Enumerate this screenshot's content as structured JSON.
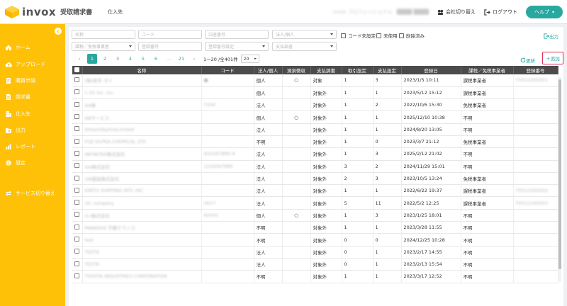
{
  "header": {
    "brand": "invox",
    "product": "受取請求書",
    "page_tab": "仕入先",
    "org_name": "invox プロフェッショナル",
    "user_name": "████ ████",
    "switch_company": "会社切り替え",
    "logout": "ログアウト",
    "help": "ヘルプ"
  },
  "colors": {
    "accent": "#29a8a0",
    "sidebar": "#ffc107",
    "highlight": "#e0305f"
  },
  "sidebar": {
    "items": [
      {
        "label": "ホーム",
        "icon": "home-icon"
      },
      {
        "label": "アップロード",
        "icon": "upload-icon"
      },
      {
        "label": "購買申請",
        "icon": "purchase-request-icon"
      },
      {
        "label": "請求書",
        "icon": "invoice-icon"
      },
      {
        "label": "仕入先",
        "icon": "supplier-icon"
      },
      {
        "label": "出力",
        "icon": "export-icon"
      },
      {
        "label": "レポート",
        "icon": "report-icon"
      },
      {
        "label": "設定",
        "icon": "gear-icon"
      }
    ],
    "service_switch": "サービス切り替え"
  },
  "filters": {
    "name": "名称",
    "code": "コード",
    "bank_account": "口座番号",
    "entity_type": "法人/個人",
    "code_unset": "コード未設定",
    "unused": "未使用",
    "deleted": "削除済み",
    "export": "出力",
    "tax_status": "課税／免税事業者",
    "reg_number": "登録番号",
    "reg_number_setting": "登録番号設定",
    "payment_survey": "支払調書"
  },
  "pager": {
    "pages": [
      "1",
      "2",
      "3",
      "4",
      "5",
      "6",
      "…",
      "21"
    ],
    "count": "1〜20 /全401件",
    "per_page": "20"
  },
  "actions": {
    "refresh": "更新",
    "add": "＋追加"
  },
  "table": {
    "headers": [
      "",
      "名称",
      "コード",
      "法人/個人",
      "源泉徴収",
      "支払調書",
      "取引設定",
      "支払設定",
      "登録日",
      "課税／免税事業者",
      "登録番号"
    ],
    "rows": [
      {
        "name": "(株)岩手 ガイ",
        "code": "■",
        "entity": "個人",
        "withholding": "○",
        "survey": "対象",
        "trade": "1",
        "pay": "3",
        "date": "2023/1/5 10:11",
        "tax": "課税事業者",
        "reg": "T0512345001"
      },
      {
        "name": "1-55 Inc. Inc.",
        "code": "",
        "entity": "個人",
        "withholding": "",
        "survey": "対象外",
        "trade": "1",
        "pay": "1",
        "date": "2023/5/12 15:12",
        "tax": "課税事業者",
        "reg": ""
      },
      {
        "name": "AA株",
        "code": "T204",
        "entity": "法人",
        "withholding": "",
        "survey": "対象外",
        "trade": "1",
        "pay": "2",
        "date": "2022/10/6 15:30",
        "tax": "免税事業者",
        "reg": ""
      },
      {
        "name": "ABサービス",
        "code": "",
        "entity": "個人",
        "withholding": "○",
        "survey": "対象外",
        "trade": "1",
        "pay": "1",
        "date": "2025/12/10 10:38",
        "tax": "不明",
        "reg": ""
      },
      {
        "name": "DreamSkylineLimited",
        "code": "",
        "entity": "法人",
        "withholding": "",
        "survey": "対象外",
        "trade": "1",
        "pay": "1",
        "date": "2024/8/20 13:05",
        "tax": "不明",
        "reg": ""
      },
      {
        "name": "FUJI SILPEA CHEMICAL LTD.",
        "code": "",
        "entity": "不明",
        "withholding": "",
        "survey": "対象外",
        "trade": "1",
        "pay": "0",
        "date": "2023/3/7 21:12",
        "tax": "免税事業者",
        "reg": ""
      },
      {
        "name": "INFINITAS株式会社",
        "code": "A55267890-9",
        "entity": "法人",
        "withholding": "",
        "survey": "対象外",
        "trade": "1",
        "pay": "3",
        "date": "2025/2/12 21:02",
        "tax": "不明",
        "reg": ""
      },
      {
        "name": "GH株式会社",
        "code": "1234567890",
        "entity": "法人",
        "withholding": "",
        "survey": "対象外",
        "trade": "3",
        "pay": "2",
        "date": "2024/11/29 15:01",
        "tax": "不明",
        "reg": ""
      },
      {
        "name": "GN建設株式会社",
        "code": "",
        "entity": "法人",
        "withholding": "",
        "survey": "対象外",
        "trade": "2",
        "pay": "3",
        "date": "2023/10/5 13:24",
        "tax": "免税事業者",
        "reg": ""
      },
      {
        "name": "KINTO SHIPPING INTL INC",
        "code": "",
        "entity": "法人",
        "withholding": "",
        "survey": "対象外",
        "trade": "1",
        "pay": "1",
        "date": "2022/6/22 19:37",
        "tax": "課税事業者",
        "reg": "T0512345002"
      },
      {
        "name": "nlc company",
        "code": "0017",
        "entity": "法人",
        "withholding": "",
        "survey": "対象外",
        "trade": "5",
        "pay": "11",
        "date": "2022/5/2 12:25",
        "tax": "課税事業者",
        "reg": "T0512345003"
      },
      {
        "name": "O-I株式会社",
        "code": "A0001",
        "entity": "個人",
        "withholding": "○",
        "survey": "対象外",
        "trade": "1",
        "pay": "3",
        "date": "2023/1/25 18:01",
        "tax": "不明",
        "reg": ""
      },
      {
        "name": "PARADOX 不動テクノス",
        "code": "",
        "entity": "不明",
        "withholding": "",
        "survey": "対象外",
        "trade": "1",
        "pay": "1",
        "date": "2023/3/28 11:55",
        "tax": "不明",
        "reg": ""
      },
      {
        "name": "test",
        "code": "",
        "entity": "不明",
        "withholding": "",
        "survey": "対象外",
        "trade": "0",
        "pay": "0",
        "date": "2024/12/25 10:28",
        "tax": "不明",
        "reg": ""
      },
      {
        "name": "TEST6",
        "code": "",
        "entity": "法人",
        "withholding": "",
        "survey": "対象外",
        "trade": "0",
        "pay": "1",
        "date": "2023/2/17 14:55",
        "tax": "不明",
        "reg": ""
      },
      {
        "name": "TEST8",
        "code": "",
        "entity": "法人",
        "withholding": "",
        "survey": "対象外",
        "trade": "0",
        "pay": "1",
        "date": "2023/2/13 15:54",
        "tax": "不明",
        "reg": ""
      },
      {
        "name": "TOYOTA INDUSTRIES CORPORATION",
        "code": "",
        "entity": "不明",
        "withholding": "",
        "survey": "対象外",
        "trade": "1",
        "pay": "1",
        "date": "2023/3/17 12:52",
        "tax": "不明",
        "reg": ""
      }
    ]
  }
}
